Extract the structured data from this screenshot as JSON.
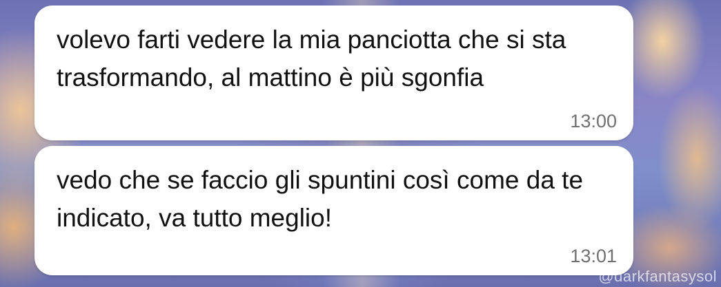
{
  "chat": {
    "messages": [
      {
        "text": "volevo farti vedere la mia panciotta che si sta trasformando, al mattino è più sgonfia",
        "time": "13:00"
      },
      {
        "text": "vedo che se faccio gli spuntini così come da te indicato, va tutto meglio!",
        "time": "13:01"
      }
    ],
    "bubble_color": "#ffffff",
    "time_color": "#707070"
  },
  "wallpaper": {
    "watermark": "@darkfantasysol"
  }
}
